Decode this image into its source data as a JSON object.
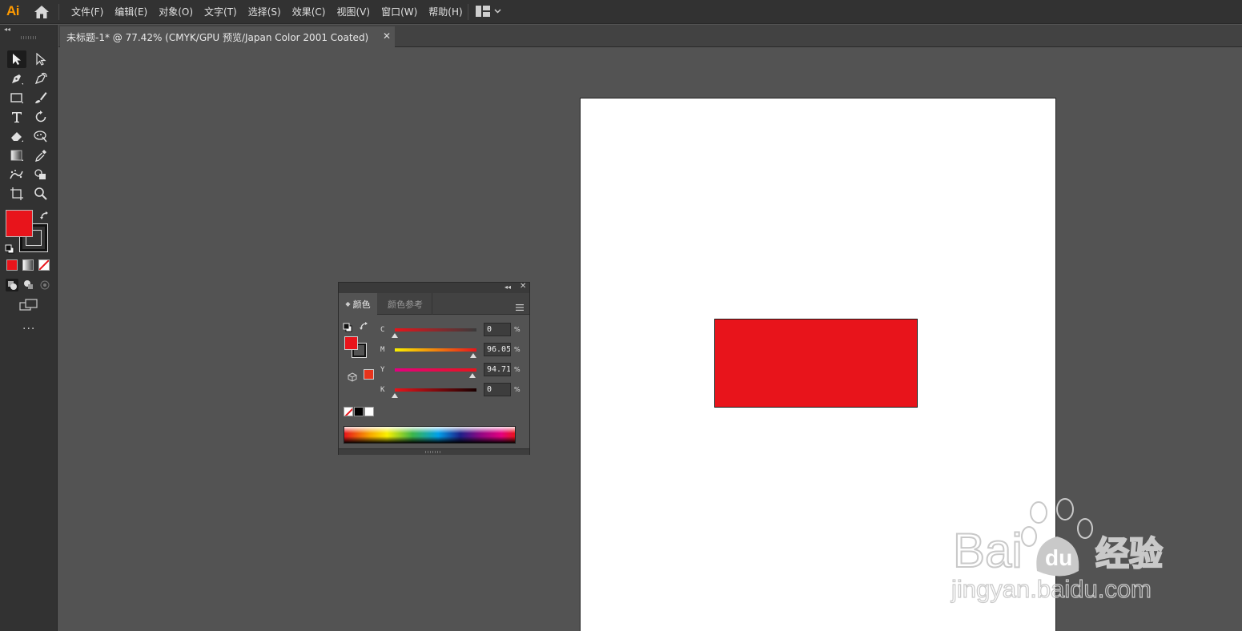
{
  "app": {
    "logo": "Ai",
    "menu": [
      "文件(F)",
      "编辑(E)",
      "对象(O)",
      "文字(T)",
      "选择(S)",
      "效果(C)",
      "视图(V)",
      "窗口(W)",
      "帮助(H)"
    ]
  },
  "document": {
    "tab_title": "未标题-1* @ 77.42% (CMYK/GPU 预览/Japan Color 2001 Coated)",
    "close_glyph": "✕"
  },
  "toolbar": {
    "collapse_glyph": "◂◂",
    "more_glyph": "···",
    "fill_color": "#e8141b",
    "stroke_color": "#111111"
  },
  "color_panel": {
    "collapse_glyph": "◂◂",
    "close_glyph": "✕",
    "tabs": [
      "颜色",
      "颜色参考"
    ],
    "active_tab_arrow": "◆",
    "fill_color": "#e8141b",
    "sliders": [
      {
        "label": "C",
        "value": "0",
        "unit": "%",
        "fraction": 0.0,
        "track": "linear-gradient(to right,#e8141b,#3a3a3a)"
      },
      {
        "label": "M",
        "value": "96.05",
        "unit": "%",
        "fraction": 0.9605,
        "track": "linear-gradient(to right,#f9f000,#e8141b)"
      },
      {
        "label": "Y",
        "value": "94.71",
        "unit": "%",
        "fraction": 0.9471,
        "track": "linear-gradient(to right,#e4007f,#e8141b)"
      },
      {
        "label": "K",
        "value": "0",
        "unit": "%",
        "fraction": 0.0,
        "track": "linear-gradient(to right,#e8141b,#1a0000)"
      }
    ]
  },
  "canvas": {
    "rectangle_fill": "#e8141b"
  },
  "watermark": {
    "brand_latin": "Bai",
    "brand_paw_text": "du",
    "brand_cn": "经验",
    "url": "jingyan.baidu.com"
  }
}
